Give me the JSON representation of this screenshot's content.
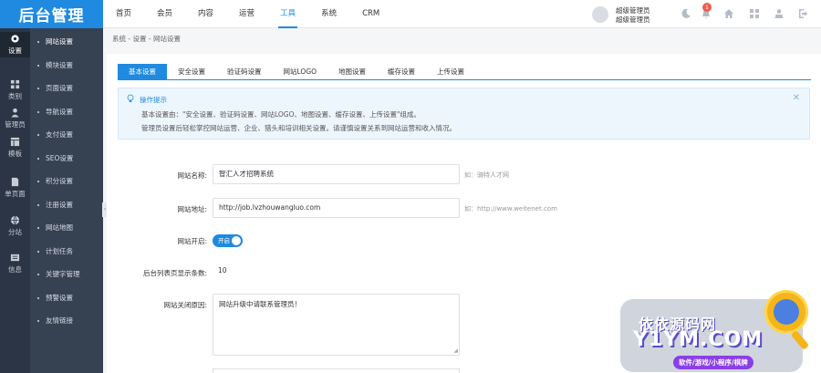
{
  "app": {
    "logo": "后台管理"
  },
  "topnav": [
    "首页",
    "会员",
    "内容",
    "运营",
    "工具",
    "系统",
    "CRM"
  ],
  "topnav_active_index": 4,
  "user": {
    "name": "超级管理员",
    "role": "超级管理员",
    "caret": "▾",
    "avatar_icon": "user-avatar"
  },
  "notifications": {
    "count": "1"
  },
  "top_icons": [
    "moon-icon",
    "bell-icon",
    "home-icon",
    "grid-icon",
    "tshirt-icon",
    "person-icon",
    "logout-icon"
  ],
  "iconbar": [
    {
      "label": "设置",
      "icon": "gear-icon"
    },
    {
      "label": "类别",
      "icon": "category-icon"
    },
    {
      "label": "管理员",
      "icon": "admin-icon"
    },
    {
      "label": "模板",
      "icon": "template-icon"
    },
    {
      "label": "单页面",
      "icon": "page-icon"
    },
    {
      "label": "分站",
      "icon": "substation-icon"
    },
    {
      "label": "信息",
      "icon": "message-icon"
    }
  ],
  "subbar": [
    "网站设置",
    "模块设置",
    "页面设置",
    "导航设置",
    "支付设置",
    "SEO设置",
    "积分设置",
    "注册设置",
    "网站地图",
    "计划任务",
    "关键字管理",
    "预警设置",
    "友情链接"
  ],
  "breadcrumb": "系统 - 设置 - 网站设置",
  "tabs": [
    "基本设置",
    "安全设置",
    "验证码设置",
    "网站LOGO",
    "地图设置",
    "缓存设置",
    "上传设置"
  ],
  "tips": {
    "title": "操作提示",
    "line1": "基本设置由：\"安全设置、验证码设置、网站LOGO、地图设置、缓存设置、上传设置\"组成。",
    "line2": "管理员设置后轻松掌控网站运营、企业、猎头和培训相关设置。请谨慎设置关系到网站运营和收入情况。",
    "close": "✕"
  },
  "form": {
    "site_name_label": "网站名称:",
    "site_name_value": "智汇人才招聘系统",
    "site_name_hint": "如：骑特人才网",
    "site_url_label": "网站地址:",
    "site_url_value": "http://job.lvzhouwangluo.com",
    "site_url_hint": "如：http://www.weitenet.com",
    "site_open_label": "网站开启:",
    "site_open_value": "开启",
    "list_count_label": "后台列表页显示条数:",
    "list_count_value": "10",
    "close_reason_label": "网站关闭原因:",
    "close_reason_value": "网站升级中请联系管理员！"
  },
  "watermark": {
    "cn": "依依源码网",
    "en": "Y1YM.COM",
    "tag": "软件/游戏/小程序/棋牌"
  },
  "colors": {
    "accent": "#1f8ae0",
    "sidebar_dark": "#2b3545",
    "sidebar": "#364152",
    "badge": "#f05a4b"
  }
}
